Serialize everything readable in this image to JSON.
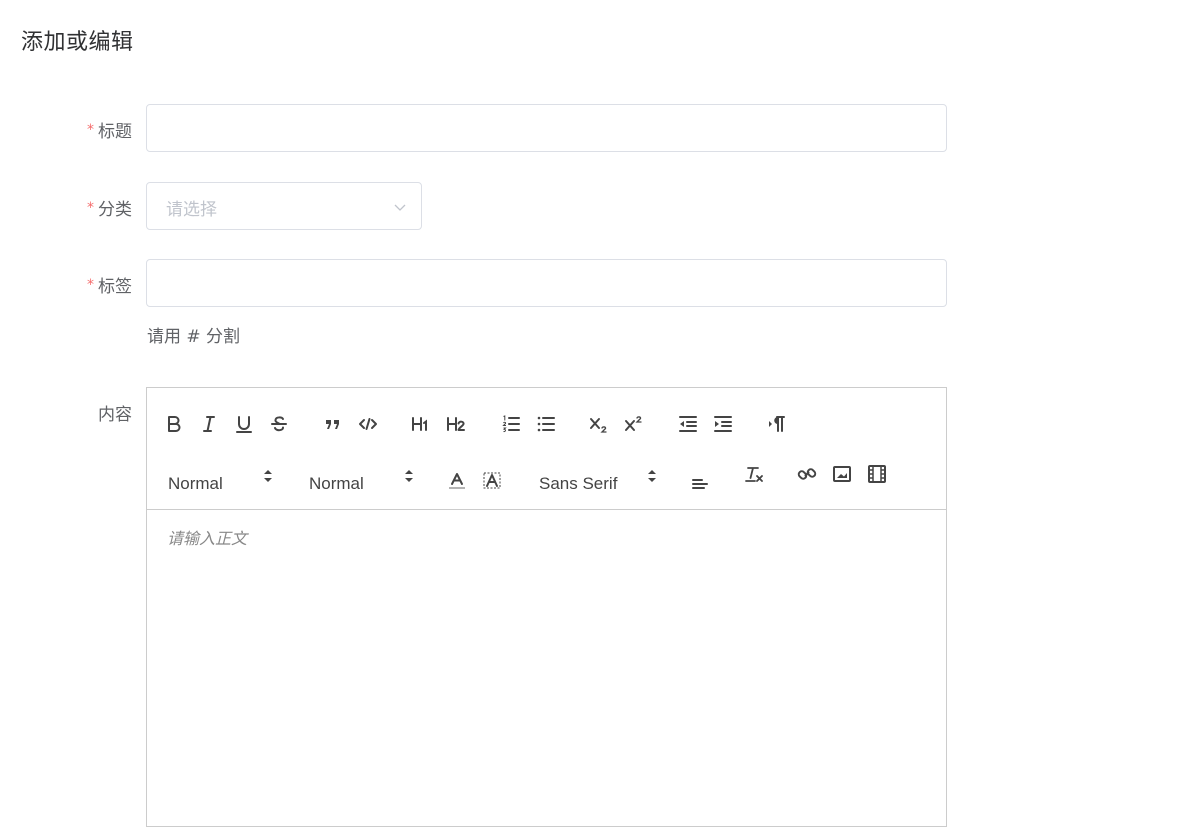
{
  "page": {
    "title": "添加或编辑"
  },
  "form": {
    "required_mark": "*",
    "title_label": "标题",
    "category_label": "分类",
    "category_placeholder": "请选择",
    "tags_label": "标签",
    "tags_hint": "请用 # 分割",
    "content_label": "内容"
  },
  "editor": {
    "header_picker": "Normal",
    "size_picker": "Normal",
    "font_picker": "Sans Serif",
    "placeholder": "请输入正文"
  },
  "icons": [
    "bold-icon",
    "italic-icon",
    "underline-icon",
    "strike-icon",
    "blockquote-icon",
    "code-block-icon",
    "header1-icon",
    "header2-icon",
    "ordered-list-icon",
    "bullet-list-icon",
    "subscript-icon",
    "superscript-icon",
    "outdent-icon",
    "indent-icon",
    "direction-rtl-icon",
    "font-color-icon",
    "background-color-icon",
    "align-icon",
    "clean-format-icon",
    "link-icon",
    "image-icon",
    "video-icon"
  ],
  "colors": {
    "required": "#f56c6c",
    "border": "#dcdfe6",
    "editor_border": "#cccccc",
    "label": "#606266",
    "placeholder": "#c0c4cc",
    "icon": "#444444"
  }
}
